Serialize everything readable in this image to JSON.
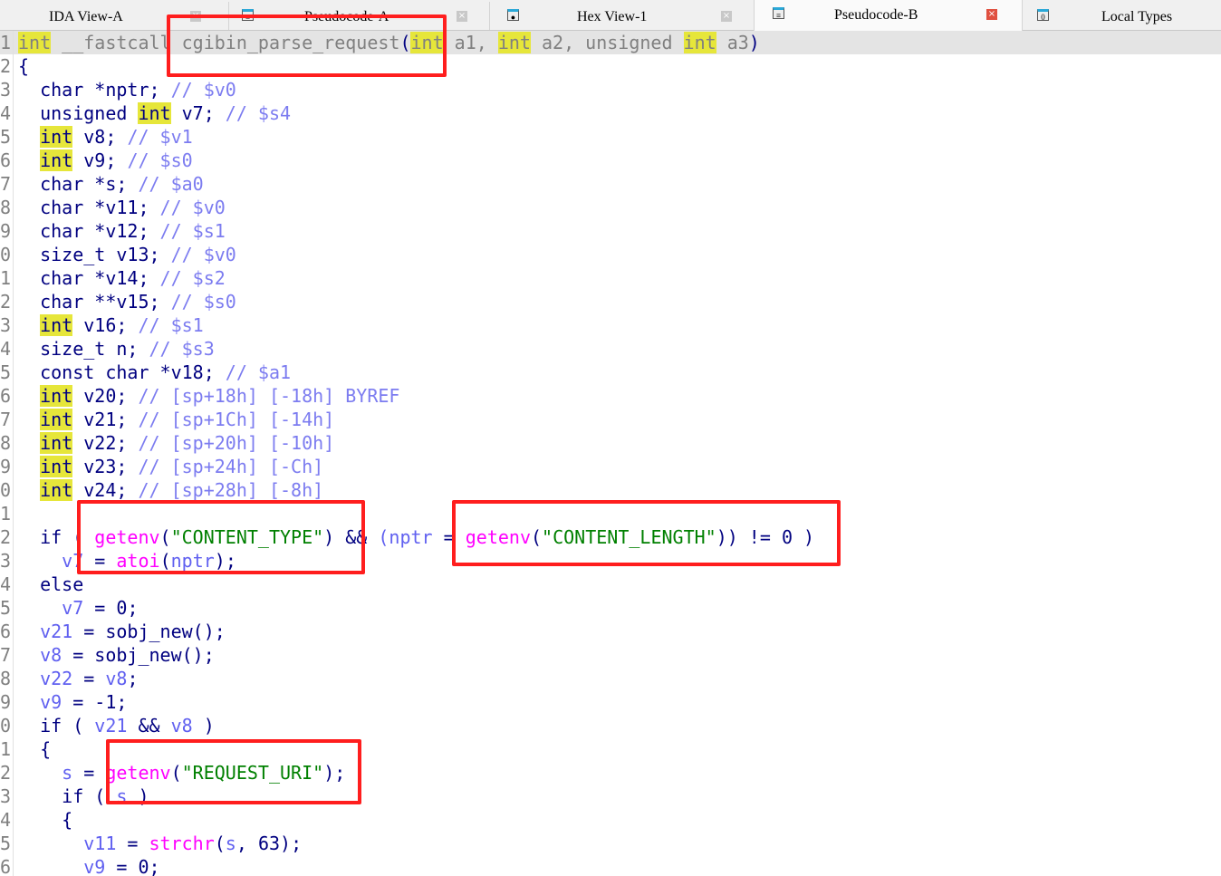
{
  "tabs": [
    {
      "label": "IDA View-A",
      "icon": "disassembly-icon",
      "active": false
    },
    {
      "label": "Pseudocode-A",
      "icon": "pseudocode-icon",
      "active": false
    },
    {
      "label": "Hex View-1",
      "icon": "hex-icon",
      "active": false
    },
    {
      "label": "Pseudocode-B",
      "icon": "pseudocode-icon",
      "active": true
    },
    {
      "label": "Local Types",
      "icon": "types-icon",
      "active": false
    }
  ],
  "colors": {
    "highlight": "#e6e63a",
    "annotation_box": "#ff1e1e",
    "function": "#ff00ff",
    "string": "#008000",
    "keyword": "#000080",
    "variable": "#6060f0"
  },
  "highlight_word": "int",
  "lines": [
    {
      "n": "1",
      "cur": true,
      "t": [
        [
          "g",
          "int"
        ],
        [
          "g",
          " __fastcall cgibin_parse_request"
        ],
        [
          "p",
          "("
        ],
        [
          "g",
          "int"
        ],
        [
          "g",
          " a1, "
        ],
        [
          "g",
          "int"
        ],
        [
          "g",
          " a2, unsigned "
        ],
        [
          "g",
          "int"
        ],
        [
          "g",
          " a3"
        ],
        [
          "p",
          ")"
        ]
      ]
    },
    {
      "n": "2",
      "t": [
        [
          "p",
          "{"
        ]
      ]
    },
    {
      "n": "3",
      "t": [
        [
          "kw",
          "  char *nptr; "
        ],
        [
          "cm",
          "// $v0"
        ]
      ]
    },
    {
      "n": "4",
      "t": [
        [
          "kw",
          "  unsigned "
        ],
        [
          "kw",
          "int"
        ],
        [
          "kw",
          " v7; "
        ],
        [
          "cm",
          "// $s4"
        ]
      ]
    },
    {
      "n": "5",
      "t": [
        [
          "kw",
          "  "
        ],
        [
          "kw",
          "int"
        ],
        [
          "kw",
          " v8; "
        ],
        [
          "cm",
          "// $v1"
        ]
      ]
    },
    {
      "n": "6",
      "t": [
        [
          "kw",
          "  "
        ],
        [
          "kw",
          "int"
        ],
        [
          "kw",
          " v9; "
        ],
        [
          "cm",
          "// $s0"
        ]
      ]
    },
    {
      "n": "7",
      "t": [
        [
          "kw",
          "  char *s; "
        ],
        [
          "cm",
          "// $a0"
        ]
      ]
    },
    {
      "n": "8",
      "t": [
        [
          "kw",
          "  char *v11; "
        ],
        [
          "cm",
          "// $v0"
        ]
      ]
    },
    {
      "n": "9",
      "t": [
        [
          "kw",
          "  char *v12; "
        ],
        [
          "cm",
          "// $s1"
        ]
      ]
    },
    {
      "n": "0",
      "t": [
        [
          "kw",
          "  size_t v13; "
        ],
        [
          "cm",
          "// $v0"
        ]
      ]
    },
    {
      "n": "1",
      "t": [
        [
          "kw",
          "  char *v14; "
        ],
        [
          "cm",
          "// $s2"
        ]
      ]
    },
    {
      "n": "2",
      "t": [
        [
          "kw",
          "  char **v15; "
        ],
        [
          "cm",
          "// $s0"
        ]
      ]
    },
    {
      "n": "3",
      "t": [
        [
          "kw",
          "  "
        ],
        [
          "kw",
          "int"
        ],
        [
          "kw",
          " v16; "
        ],
        [
          "cm",
          "// $s1"
        ]
      ]
    },
    {
      "n": "4",
      "t": [
        [
          "kw",
          "  size_t n; "
        ],
        [
          "cm",
          "// $s3"
        ]
      ]
    },
    {
      "n": "5",
      "t": [
        [
          "kw",
          "  const char *v18; "
        ],
        [
          "cm",
          "// $a1"
        ]
      ]
    },
    {
      "n": "6",
      "t": [
        [
          "kw",
          "  "
        ],
        [
          "kw",
          "int"
        ],
        [
          "kw",
          " v20; "
        ],
        [
          "cm",
          "// [sp+18h] [-18h] BYREF"
        ]
      ]
    },
    {
      "n": "7",
      "t": [
        [
          "kw",
          "  "
        ],
        [
          "kw",
          "int"
        ],
        [
          "kw",
          " v21; "
        ],
        [
          "cm",
          "// [sp+1Ch] [-14h]"
        ]
      ]
    },
    {
      "n": "8",
      "t": [
        [
          "kw",
          "  "
        ],
        [
          "kw",
          "int"
        ],
        [
          "kw",
          " v22; "
        ],
        [
          "cm",
          "// [sp+20h] [-10h]"
        ]
      ]
    },
    {
      "n": "9",
      "t": [
        [
          "kw",
          "  "
        ],
        [
          "kw",
          "int"
        ],
        [
          "kw",
          " v23; "
        ],
        [
          "cm",
          "// [sp+24h] [-Ch]"
        ]
      ]
    },
    {
      "n": "0",
      "t": [
        [
          "kw",
          "  "
        ],
        [
          "kw",
          "int"
        ],
        [
          "kw",
          " v24; "
        ],
        [
          "cm",
          "// [sp+28h] [-8h]"
        ]
      ]
    },
    {
      "n": "1",
      "t": []
    },
    {
      "n": "2",
      "t": [
        [
          "kw",
          "  if ( "
        ],
        [
          "fn",
          "getenv"
        ],
        [
          "p",
          "("
        ],
        [
          "str",
          "\"CONTENT_TYPE\""
        ],
        [
          "p",
          ") && "
        ],
        [
          "var",
          "(nptr"
        ],
        [
          "p",
          " = "
        ],
        [
          "fn",
          "getenv"
        ],
        [
          "p",
          "("
        ],
        [
          "str",
          "\"CONTENT_LENGTH\""
        ],
        [
          "p",
          ")) != "
        ],
        [
          "num",
          "0"
        ],
        [
          "p",
          " )"
        ]
      ]
    },
    {
      "n": "3",
      "t": [
        [
          "p",
          "    "
        ],
        [
          "var",
          "v7"
        ],
        [
          "p",
          " = "
        ],
        [
          "fn",
          "atoi"
        ],
        [
          "p",
          "("
        ],
        [
          "var",
          "nptr"
        ],
        [
          "p",
          ");"
        ]
      ]
    },
    {
      "n": "4",
      "t": [
        [
          "kw",
          "  else"
        ]
      ]
    },
    {
      "n": "5",
      "t": [
        [
          "p",
          "    "
        ],
        [
          "var",
          "v7"
        ],
        [
          "p",
          " = "
        ],
        [
          "num",
          "0"
        ],
        [
          "p",
          ";"
        ]
      ]
    },
    {
      "n": "6",
      "t": [
        [
          "p",
          "  "
        ],
        [
          "var",
          "v21"
        ],
        [
          "p",
          " = sobj_new();"
        ]
      ]
    },
    {
      "n": "7",
      "t": [
        [
          "p",
          "  "
        ],
        [
          "var",
          "v8"
        ],
        [
          "p",
          " = sobj_new();"
        ]
      ]
    },
    {
      "n": "8",
      "t": [
        [
          "p",
          "  "
        ],
        [
          "var",
          "v22"
        ],
        [
          "p",
          " = "
        ],
        [
          "var",
          "v8"
        ],
        [
          "p",
          ";"
        ]
      ]
    },
    {
      "n": "9",
      "t": [
        [
          "p",
          "  "
        ],
        [
          "var",
          "v9"
        ],
        [
          "p",
          " = -"
        ],
        [
          "num",
          "1"
        ],
        [
          "p",
          ";"
        ]
      ]
    },
    {
      "n": "0",
      "t": [
        [
          "kw",
          "  if ( "
        ],
        [
          "var",
          "v21"
        ],
        [
          "p",
          " && "
        ],
        [
          "var",
          "v8"
        ],
        [
          "p",
          " )"
        ]
      ]
    },
    {
      "n": "1",
      "t": [
        [
          "p",
          "  {"
        ]
      ]
    },
    {
      "n": "2",
      "t": [
        [
          "p",
          "    "
        ],
        [
          "var",
          "s"
        ],
        [
          "p",
          " = "
        ],
        [
          "fn",
          "getenv"
        ],
        [
          "p",
          "("
        ],
        [
          "str",
          "\"REQUEST_URI\""
        ],
        [
          "p",
          ");"
        ]
      ]
    },
    {
      "n": "3",
      "t": [
        [
          "kw",
          "    if ( "
        ],
        [
          "var",
          "s"
        ],
        [
          "p",
          " )"
        ]
      ]
    },
    {
      "n": "4",
      "t": [
        [
          "p",
          "    {"
        ]
      ]
    },
    {
      "n": "5",
      "t": [
        [
          "p",
          "      "
        ],
        [
          "var",
          "v11"
        ],
        [
          "p",
          " = "
        ],
        [
          "fn",
          "strchr"
        ],
        [
          "p",
          "("
        ],
        [
          "var",
          "s"
        ],
        [
          "p",
          ", "
        ],
        [
          "num",
          "63"
        ],
        [
          "p",
          ");"
        ]
      ]
    },
    {
      "n": "6",
      "t": [
        [
          "p",
          "      "
        ],
        [
          "var",
          "v9"
        ],
        [
          "p",
          " = "
        ],
        [
          "num",
          "0"
        ],
        [
          "p",
          ";"
        ]
      ]
    }
  ]
}
